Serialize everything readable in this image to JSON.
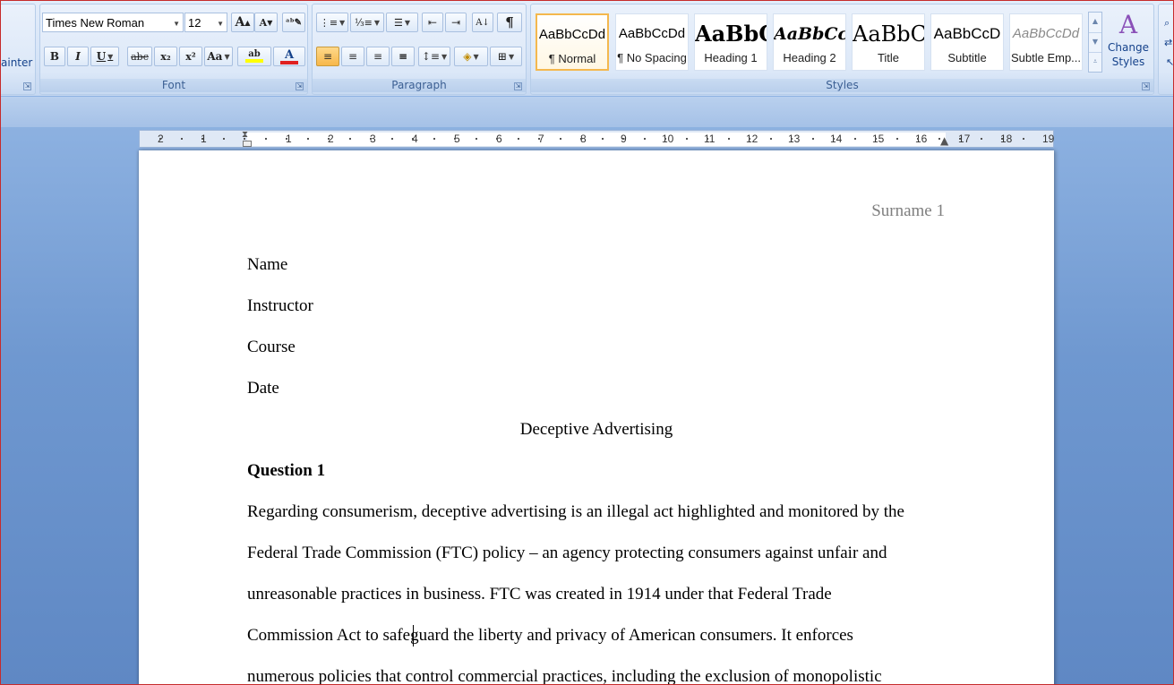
{
  "ribbon": {
    "clipboard": {
      "format_painter": "ainter"
    },
    "font": {
      "label": "Font",
      "font_name": "Times New Roman",
      "font_size": "12",
      "bold": "B",
      "italic": "I",
      "underline": "U",
      "strike": "abc",
      "subscript": "x₂",
      "superscript": "x²",
      "change_case": "Aa",
      "grow": "A",
      "shrink": "A",
      "highlight": "ab",
      "font_color": "A",
      "highlight_color": "#ffff00",
      "font_color_value": "#e02020"
    },
    "paragraph": {
      "label": "Paragraph",
      "pilcrow": "¶"
    },
    "styles": {
      "label": "Styles",
      "items": [
        {
          "preview": "AaBbCcDd",
          "name": "¶ Normal",
          "selected": true
        },
        {
          "preview": "AaBbCcDd",
          "name": "¶ No Spacing"
        },
        {
          "preview": "AaBbC",
          "name": "Heading 1"
        },
        {
          "preview": "AaBbCc",
          "name": "Heading 2"
        },
        {
          "preview": "AaBbC",
          "name": "Title"
        },
        {
          "preview": "AaBbCcD",
          "name": "Subtitle"
        },
        {
          "preview": "AaBbCcDd",
          "name": "Subtle Emp..."
        }
      ],
      "change_styles": "Change Styles"
    }
  },
  "ruler": {
    "left_numbers": [
      "2",
      "1"
    ],
    "numbers": [
      "1",
      "2",
      "3",
      "4",
      "5",
      "6",
      "7",
      "8",
      "9",
      "10",
      "11",
      "12",
      "13",
      "14",
      "15",
      "16",
      "17",
      "18",
      "19"
    ]
  },
  "document": {
    "header": "Surname 1",
    "lines": {
      "name": "Name",
      "instructor": "Instructor",
      "course": "Course",
      "date": "Date"
    },
    "title": "Deceptive Advertising",
    "question": "Question 1",
    "paragraph_lines": [
      "Regarding consumerism, deceptive advertising is an illegal act highlighted and monitored by the",
      "Federal Trade Commission (FTC) policy – an agency protecting consumers against unfair and",
      "unreasonable practices in business. FTC was created in 1914 under that Federal Trade",
      "Commission Act to safeguard the liberty and privacy of American consumers. It enforces",
      "numerous policies that control commercial practices, including the exclusion of monopolistic"
    ]
  }
}
